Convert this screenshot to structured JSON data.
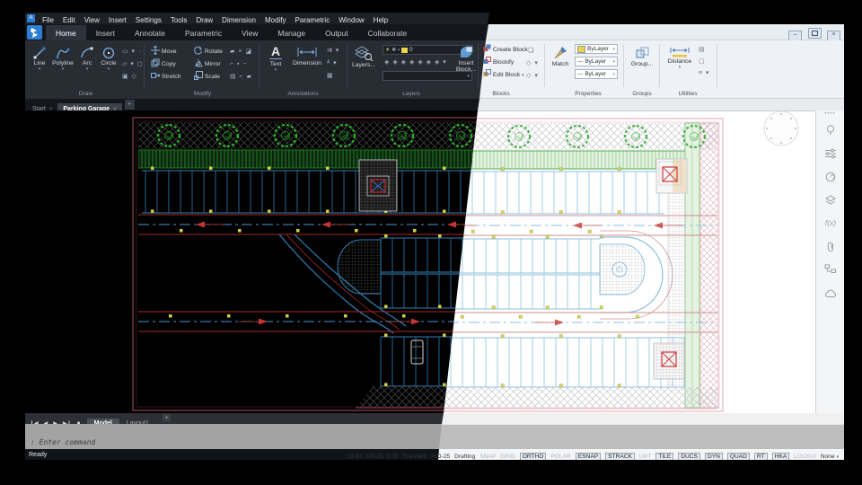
{
  "menu_bar": {
    "items": [
      "File",
      "Edit",
      "View",
      "Insert",
      "Settings",
      "Tools",
      "Draw",
      "Dimension",
      "Modify",
      "Parametric",
      "Window",
      "Help"
    ]
  },
  "ribbon_tabs": {
    "items": [
      "Home",
      "Insert",
      "Annotate",
      "Parametric",
      "View",
      "Manage",
      "Output",
      "Collaborate"
    ],
    "active": "Home"
  },
  "window_buttons": {
    "minimize": "–",
    "restore": "",
    "close": "×"
  },
  "ribbon": {
    "draw": {
      "caption": "Draw",
      "tools": [
        "Line",
        "Polyline",
        "Arc",
        "Circle"
      ]
    },
    "modify": {
      "caption": "Modify",
      "col1": [
        "Move",
        "Copy",
        "Stretch"
      ],
      "col2": [
        "Rotate",
        "Mirror",
        "Scale"
      ]
    },
    "annotations": {
      "caption": "Annotations",
      "text_tool": "Text",
      "dimension_tool": "Dimension"
    },
    "layers": {
      "caption": "Layers",
      "button": "Layers...",
      "current_layer": "0"
    },
    "blocks": {
      "caption": "Blocks",
      "insert_line1": "Insert",
      "insert_line2": "Block...",
      "items": [
        "Create Block",
        "Blockify",
        "Edit Block"
      ]
    },
    "properties": {
      "caption": "Properties",
      "match": "Match",
      "rows": [
        "ByLayer",
        "ByLayer",
        "ByLayer"
      ],
      "layer_color": "#e8d44d"
    },
    "groups": {
      "caption": "Groups",
      "button": "Group..."
    },
    "utilities": {
      "caption": "Utilities",
      "button": "Distance"
    }
  },
  "doc_tabs": {
    "items": [
      {
        "label": "Start",
        "active": false
      },
      {
        "label": "Parking Garage",
        "active": true
      }
    ],
    "add_label": "+"
  },
  "layout_bar": {
    "tabs": [
      {
        "label": "Model",
        "active": true
      },
      {
        "label": "Layout1",
        "active": false
      }
    ],
    "add_label": "+"
  },
  "command_line": {
    "prompt": ": Enter command"
  },
  "status_bar": {
    "ready": "Ready",
    "coordinates": "13.67, 243.31, 0.00",
    "fields": [
      "Standard",
      "ISO-25",
      "Drafting"
    ],
    "toggles": [
      {
        "label": "SNAP",
        "on": false
      },
      {
        "label": "GRID",
        "on": false
      },
      {
        "label": "ORTHO",
        "on": true
      },
      {
        "label": "POLAR",
        "on": false
      },
      {
        "label": "ESNAP",
        "on": true
      },
      {
        "label": "STRACK",
        "on": true
      },
      {
        "label": "LWT",
        "on": false
      },
      {
        "label": "TILE",
        "on": true
      },
      {
        "label": "DUCS",
        "on": true
      },
      {
        "label": "DYN",
        "on": true
      },
      {
        "label": "QUAD",
        "on": true
      },
      {
        "label": "RT",
        "on": true
      },
      {
        "label": "HKA",
        "on": true
      },
      {
        "label": "LOCKUI",
        "on": false
      }
    ],
    "annotation_scale": "None"
  },
  "sidebar": {
    "icons": [
      "bulb",
      "sliders",
      "spiral",
      "layers",
      "fx",
      "paperclip",
      "structure",
      "cloud"
    ]
  },
  "drawing": {
    "subject": "Parking Garage floor plan",
    "palettes": {
      "dark": {
        "coreBg": "#1a1a1a",
        "bound": "#b05060",
        "bound2": "#7a3a48",
        "pink": "#8a4456",
        "hatch": "#484848",
        "grid": "#6e6e6e",
        "stall": "#2f7fb5",
        "hedgeFill": "#0c2410",
        "hedge": "#2aa52a",
        "hedgeDark": "#1c7a1c",
        "tree": "#2ab52a",
        "treeIn": "#1a8a1a",
        "road": "#a82828",
        "arrow": "#c43434",
        "center": "#4f8fd0",
        "dot": "#d6d63a",
        "grey": "#9a9a9a",
        "white": "#d8d8d8",
        "redX": "#cc2626",
        "blueX": "#3a68c4",
        "stripe": "#6a5a28"
      },
      "light": {
        "coreBg": "#f7f7f7",
        "bound": "#e0a4b2",
        "bound2": "#d494a4",
        "pink": "#dcaab8",
        "hatch": "#c6c6cc",
        "grid": "#b0b0b8",
        "stall": "#8cc0dd",
        "hedgeFill": "#e6f2e2",
        "hedge": "#7cc47c",
        "hedgeDark": "#5aa85a",
        "tree": "#4db04d",
        "treeIn": "#7cc47c",
        "road": "#cc9090",
        "arrow": "#cc5a5a",
        "center": "#92bee2",
        "dot": "#d8d84a",
        "grey": "#bcbcbc",
        "white": "#8a8a8a",
        "redX": "#cc3a3a",
        "blueX": "#6078c8",
        "stripe": "#e8d0a0"
      }
    }
  }
}
